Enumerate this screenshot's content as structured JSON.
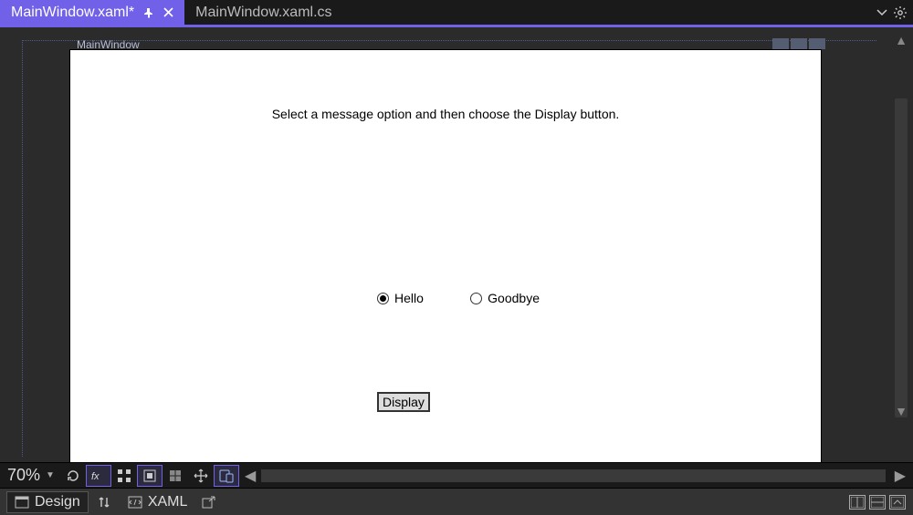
{
  "tabs": {
    "active": {
      "label": "MainWindow.xaml*"
    },
    "inactive": {
      "label": "MainWindow.xaml.cs"
    }
  },
  "designer": {
    "windowTitle": "MainWindow",
    "instruction": "Select a message option and then choose the Display button.",
    "radioHello": "Hello",
    "radioGoodbye": "Goodbye",
    "displayButton": "Display"
  },
  "tools": {
    "zoom": "70%"
  },
  "splitbar": {
    "design": "Design",
    "xaml": "XAML"
  }
}
